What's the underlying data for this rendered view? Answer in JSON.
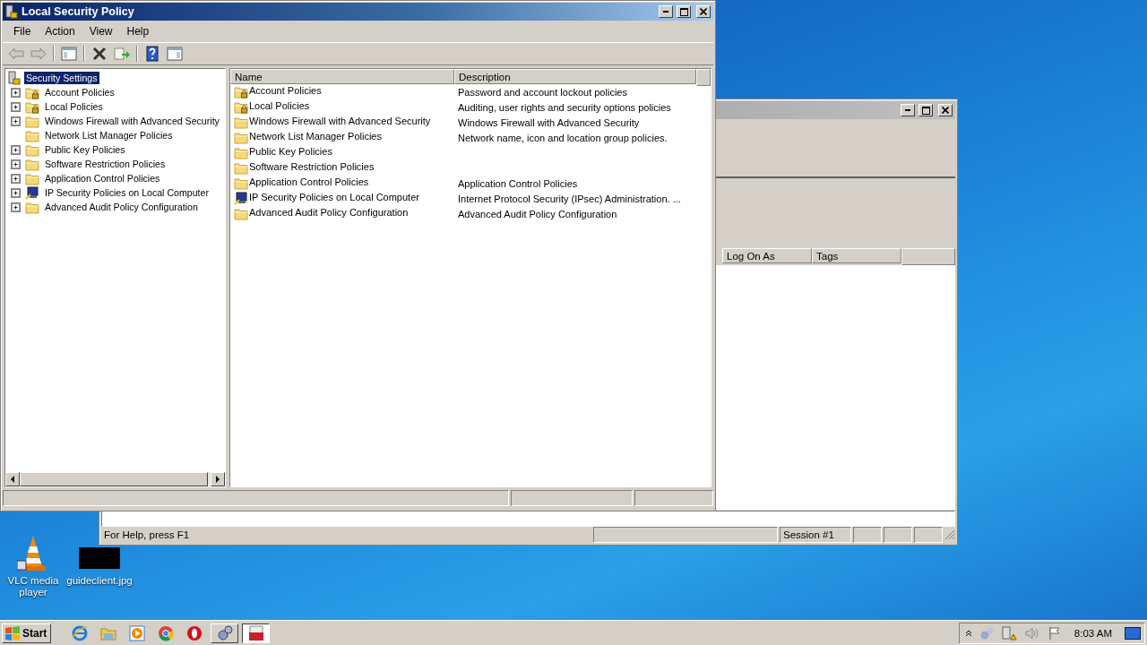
{
  "front_window": {
    "title": "Local Security Policy",
    "menu": [
      "File",
      "Action",
      "View",
      "Help"
    ],
    "tree": {
      "label": "Security Settings",
      "selected": true,
      "children": [
        {
          "label": "Account Policies",
          "kind": "locked-folder",
          "expandable": true,
          "selected": false
        },
        {
          "label": "Local Policies",
          "kind": "locked-folder",
          "expandable": true,
          "selected": false
        },
        {
          "label": "Windows Firewall with Advanced Security",
          "kind": "folder",
          "expandable": true,
          "selected": false
        },
        {
          "label": "Network List Manager Policies",
          "kind": "folder",
          "expandable": false,
          "selected": false
        },
        {
          "label": "Public Key Policies",
          "kind": "folder",
          "expandable": true,
          "selected": false
        },
        {
          "label": "Software Restriction Policies",
          "kind": "folder",
          "expandable": true,
          "selected": false
        },
        {
          "label": "Application Control Policies",
          "kind": "folder",
          "expandable": true,
          "selected": false
        },
        {
          "label": "IP Security Policies on Local Computer",
          "kind": "computer",
          "expandable": true,
          "selected": false
        },
        {
          "label": "Advanced Audit Policy Configuration",
          "kind": "folder",
          "expandable": true,
          "selected": false
        }
      ]
    },
    "list": {
      "columns": [
        "Name",
        "Description"
      ],
      "rows": [
        {
          "name": "Account Policies",
          "description": "Password and account lockout policies",
          "kind": "locked-folder"
        },
        {
          "name": "Local Policies",
          "description": "Auditing, user rights and security options policies",
          "kind": "locked-folder"
        },
        {
          "name": "Windows Firewall with Advanced Security",
          "description": "Windows Firewall with Advanced Security",
          "kind": "folder"
        },
        {
          "name": "Network List Manager Policies",
          "description": "Network name, icon and location group policies.",
          "kind": "folder"
        },
        {
          "name": "Public Key Policies",
          "kind": "folder"
        },
        {
          "name": "Software Restriction Policies",
          "kind": "folder"
        },
        {
          "name": "Application Control Policies",
          "description": "Application Control Policies",
          "kind": "folder"
        },
        {
          "name": "IP Security Policies on Local Computer",
          "description": "Internet Protocol Security (IPsec) Administration. ...",
          "kind": "computer"
        },
        {
          "name": "Advanced Audit Policy Configuration",
          "description": "Advanced Audit Policy Configuration",
          "kind": "folder"
        }
      ]
    }
  },
  "back_window": {
    "columns": [
      "Log On As",
      "Tags"
    ],
    "status": "For Help, press F1",
    "session": "Session #1"
  },
  "desktop_icons": [
    {
      "label": "VLC media player",
      "kind": "cone"
    },
    {
      "label": "guideclient.jpg",
      "kind": "image"
    }
  ],
  "taskbar": {
    "start": "Start",
    "clock": "8:03 AM"
  }
}
